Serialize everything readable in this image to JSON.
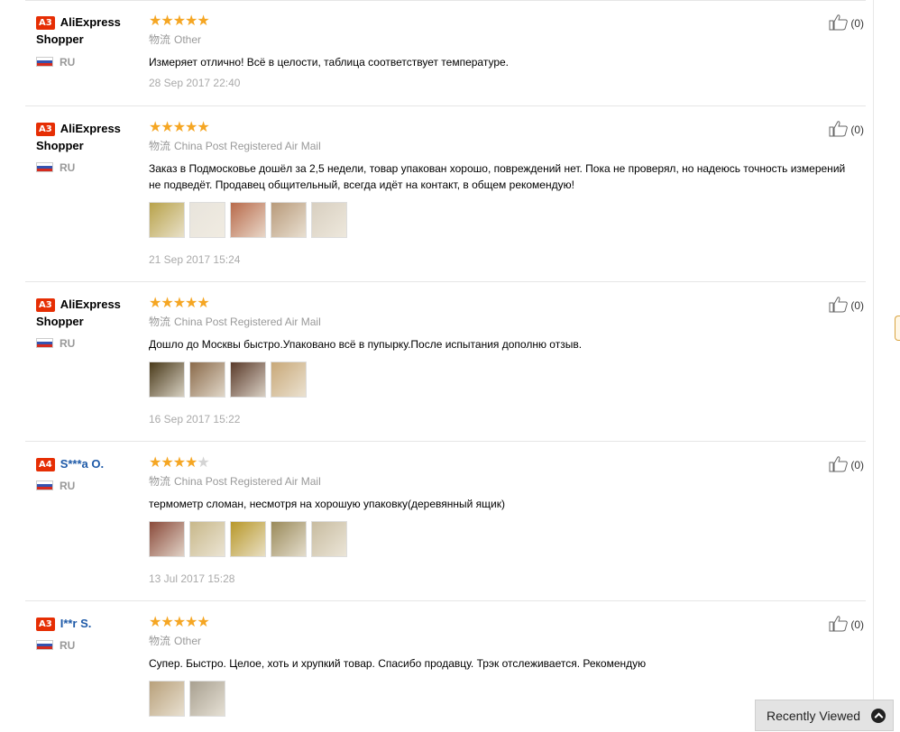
{
  "reviews": [
    {
      "level": "A3",
      "name": "AliExpress Shopper",
      "country": "RU",
      "stars": "★★★★★",
      "stars_off": "",
      "logistics_label": "物流",
      "logistics": "Other",
      "text": "Измеряет отлично! Всё в целости, таблица соответствует температуре.",
      "date": "28 Sep 2017 22:40",
      "likes": "(0)",
      "photos": []
    },
    {
      "level": "A3",
      "name": "AliExpress Shopper",
      "country": "RU",
      "stars": "★★★★★",
      "stars_off": "",
      "logistics_label": "物流",
      "logistics": "China Post Registered Air Mail",
      "text": "Заказ в Подмосковье дошёл за 2,5 недели, товар упакован хорошо, повреждений нет. Пока не проверял, но надеюсь точность измерений не подведёт. Продавец общительный, всегда идёт на контакт, в общем рекомендую!",
      "date": "21 Sep 2017 15:24",
      "likes": "(0)",
      "photos": [
        "#b8a24a",
        "#e8e4dc",
        "#b86a4a",
        "#b89a7a",
        "#d8cfc0"
      ]
    },
    {
      "level": "A3",
      "name": "AliExpress Shopper",
      "country": "RU",
      "stars": "★★★★★",
      "stars_off": "",
      "logistics_label": "物流",
      "logistics": "China Post Registered Air Mail",
      "text": "Дошло до Москвы быстро.Упаковано всё в пупырку.После испытания дополню отзыв.",
      "date": "16 Sep 2017 15:22",
      "likes": "(0)",
      "photos": [
        "#4a3a1a",
        "#8a6a4a",
        "#5a3a2a",
        "#c8a878"
      ]
    },
    {
      "level": "A4",
      "name": "S***a O.",
      "country": "RU",
      "stars": "★★★★",
      "stars_off": "★",
      "logistics_label": "物流",
      "logistics": "China Post Registered Air Mail",
      "text": "термометр сломан, несмотря на хорошую упаковку(деревянный ящик)",
      "date": "13 Jul 2017 15:28",
      "likes": "(0)",
      "photos": [
        "#8a4a3a",
        "#c8b88a",
        "#b8982a",
        "#9a8a5a",
        "#c8bca0"
      ]
    },
    {
      "level": "A3",
      "name": "I**r S.",
      "country": "RU",
      "stars": "★★★★★",
      "stars_off": "",
      "logistics_label": "物流",
      "logistics": "Other",
      "text": "Супер. Быстро. Целое, хоть и хрупкий товар. Спасибо продавцу. Трэк отслеживается. Рекомендую",
      "date": "",
      "likes": "(0)",
      "photos": [
        "#b8a07a",
        "#a8a090"
      ]
    }
  ],
  "recently_viewed": "Recently Viewed",
  "colors": {
    "accent": "#e62e04",
    "stars": "#f5a623",
    "link": "#1e5aa8"
  }
}
